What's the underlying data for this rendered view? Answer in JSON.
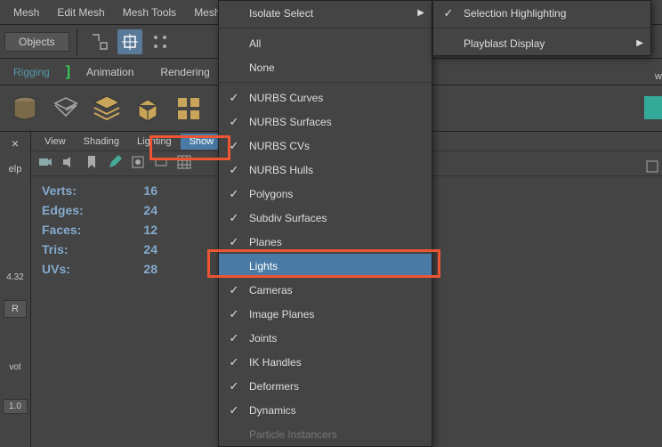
{
  "top_menu": [
    "Mesh",
    "Edit Mesh",
    "Mesh Tools",
    "Mesh D"
  ],
  "objects_label": "Objects",
  "tabs": {
    "rigging": "Rigging",
    "animation": "Animation",
    "rendering": "Rendering"
  },
  "help_label": "elp",
  "close": "×",
  "side_val": "4.32",
  "side_r": "R",
  "side_vot": "vot",
  "side_one": "1.0",
  "vp_menu": {
    "view": "View",
    "shading": "Shading",
    "lighting": "Lighting",
    "show": "Show"
  },
  "stats": [
    {
      "label": "Verts:",
      "value": "16"
    },
    {
      "label": "Edges:",
      "value": "24"
    },
    {
      "label": "Faces:",
      "value": "12"
    },
    {
      "label": "Tris:",
      "value": "24"
    },
    {
      "label": "UVs:",
      "value": "28"
    }
  ],
  "show_menu": {
    "isolate": "Isolate Select",
    "all": "All",
    "none": "None",
    "items": [
      {
        "label": "NURBS Curves",
        "checked": true
      },
      {
        "label": "NURBS Surfaces",
        "checked": true
      },
      {
        "label": "NURBS CVs",
        "checked": true
      },
      {
        "label": "NURBS Hulls",
        "checked": true
      },
      {
        "label": "Polygons",
        "checked": true
      },
      {
        "label": "Subdiv Surfaces",
        "checked": true
      },
      {
        "label": "Planes",
        "checked": true
      },
      {
        "label": "Lights",
        "checked": false,
        "highlighted": true
      },
      {
        "label": "Cameras",
        "checked": true
      },
      {
        "label": "Image Planes",
        "checked": true
      },
      {
        "label": "Joints",
        "checked": true
      },
      {
        "label": "IK Handles",
        "checked": true
      },
      {
        "label": "Deformers",
        "checked": true
      },
      {
        "label": "Dynamics",
        "checked": true
      },
      {
        "label": "Particle Instancers",
        "checked": false,
        "disabled": true
      }
    ]
  },
  "submenu": {
    "sel_highlight": "Selection Highlighting",
    "playblast": "Playblast Display"
  },
  "right_w": "w"
}
